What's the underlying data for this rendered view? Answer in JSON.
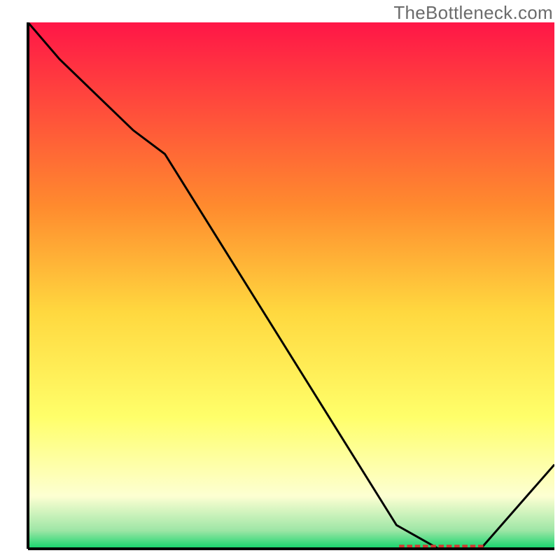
{
  "watermark": "TheBottleneck.com",
  "chart_data": {
    "type": "line",
    "title": "",
    "xlabel": "",
    "ylabel": "",
    "xlim": [
      0,
      100
    ],
    "ylim": [
      0,
      100
    ],
    "axes_visible": false,
    "grid": false,
    "background_gradient": {
      "stops": [
        {
          "offset": 0.0,
          "color": "#ff1647"
        },
        {
          "offset": 0.35,
          "color": "#ff8b2e"
        },
        {
          "offset": 0.55,
          "color": "#ffd83f"
        },
        {
          "offset": 0.75,
          "color": "#ffff6a"
        },
        {
          "offset": 0.9,
          "color": "#fdffd2"
        },
        {
          "offset": 0.965,
          "color": "#9ee6a6"
        },
        {
          "offset": 1.0,
          "color": "#12d46b"
        }
      ]
    },
    "series": [
      {
        "name": "curve",
        "color": "#000000",
        "width": 3,
        "x": [
          0,
          6,
          20,
          26,
          70,
          78,
          86,
          100
        ],
        "y": [
          100,
          93,
          79.5,
          75,
          4.5,
          0,
          0,
          16
        ]
      }
    ],
    "annotations": [
      {
        "name": "red-dashed-segment",
        "type": "dashed-line",
        "color": "#cf3a32",
        "x0": 70.5,
        "y0": 0.5,
        "x1": 87.0,
        "y1": 0.5,
        "dash_len": 1.0,
        "gap_len": 0.5,
        "width": 4
      }
    ],
    "frame": {
      "left_x": 5,
      "right_x": 99,
      "top_y": 4,
      "bottom_y": 98
    }
  }
}
